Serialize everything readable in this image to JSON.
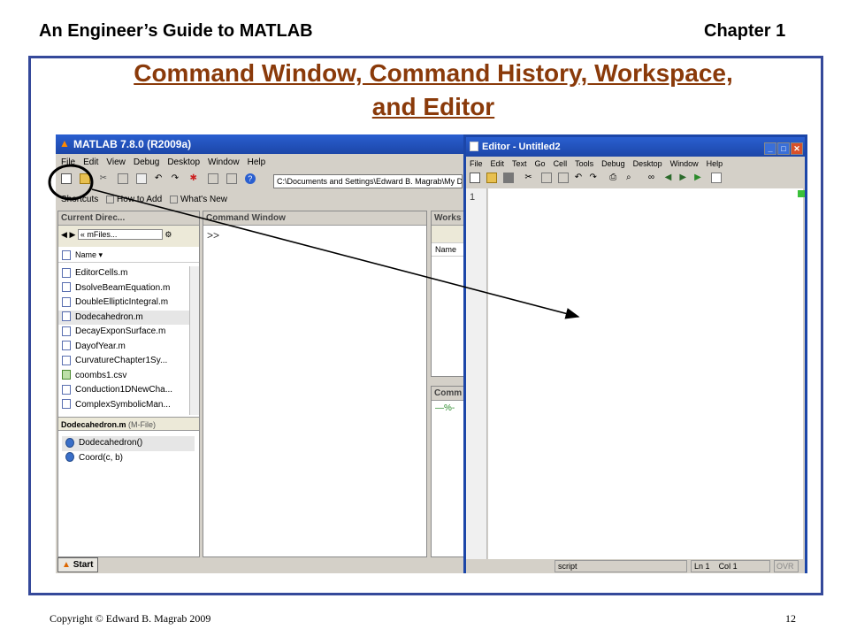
{
  "header": {
    "left": "An Engineer’s Guide to MATLAB",
    "right": "Chapter 1"
  },
  "title": {
    "line1": "Command Window, Command History, Workspace,",
    "line2": "and Editor"
  },
  "footer": {
    "copyright": "Copyright © Edward B. Magrab 2009",
    "page": "12"
  },
  "colors": {
    "frame": "#35499a",
    "title": "#8a3a0a",
    "titlebar": "#1c46a8"
  },
  "matlab": {
    "window_title": "MATLAB 7.8.0 (R2009a)",
    "menu": [
      "File",
      "Edit",
      "View",
      "Debug",
      "Desktop",
      "Window",
      "Help"
    ],
    "path": "C:\\Documents and Settings\\Edward B. Magrab\\My Do",
    "shortcuts": [
      "Shortcuts",
      "How to Add",
      "What's New"
    ],
    "current_dir": {
      "title": "Current Direc...",
      "folder": "« mFiles...",
      "col": "Name",
      "files": [
        "EditorCells.m",
        "DsolveBeamEquation.m",
        "DoubleEllipticIntegral.m",
        "Dodecahedron.m",
        "DecayExponSurface.m",
        "DayofYear.m",
        "CurvatureChapter1Sy...",
        "coombs1.csv",
        "Conduction1DNewCha...",
        "ComplexSymbolicMan..."
      ],
      "detail_title": "Dodecahedron.m",
      "detail_type": "(M-File)",
      "functions": [
        "Dodecahedron()",
        "Coord(c, b)"
      ]
    },
    "command_window": {
      "title": "Command Window",
      "prompt": ">>"
    },
    "workspace": {
      "title": "Works",
      "col": "Name"
    },
    "history": {
      "title": "Comm",
      "line": "—%-"
    },
    "start": "Start"
  },
  "editor": {
    "title": "Editor - Untitled2",
    "menu": [
      "File",
      "Edit",
      "Text",
      "Go",
      "Cell",
      "Tools",
      "Debug",
      "Desktop",
      "Window",
      "Help"
    ],
    "line_number": "1",
    "status": {
      "mode": "script",
      "ln_label": "Ln",
      "ln": "1",
      "col_label": "Col",
      "col": "1",
      "ovr": "OVR"
    }
  }
}
